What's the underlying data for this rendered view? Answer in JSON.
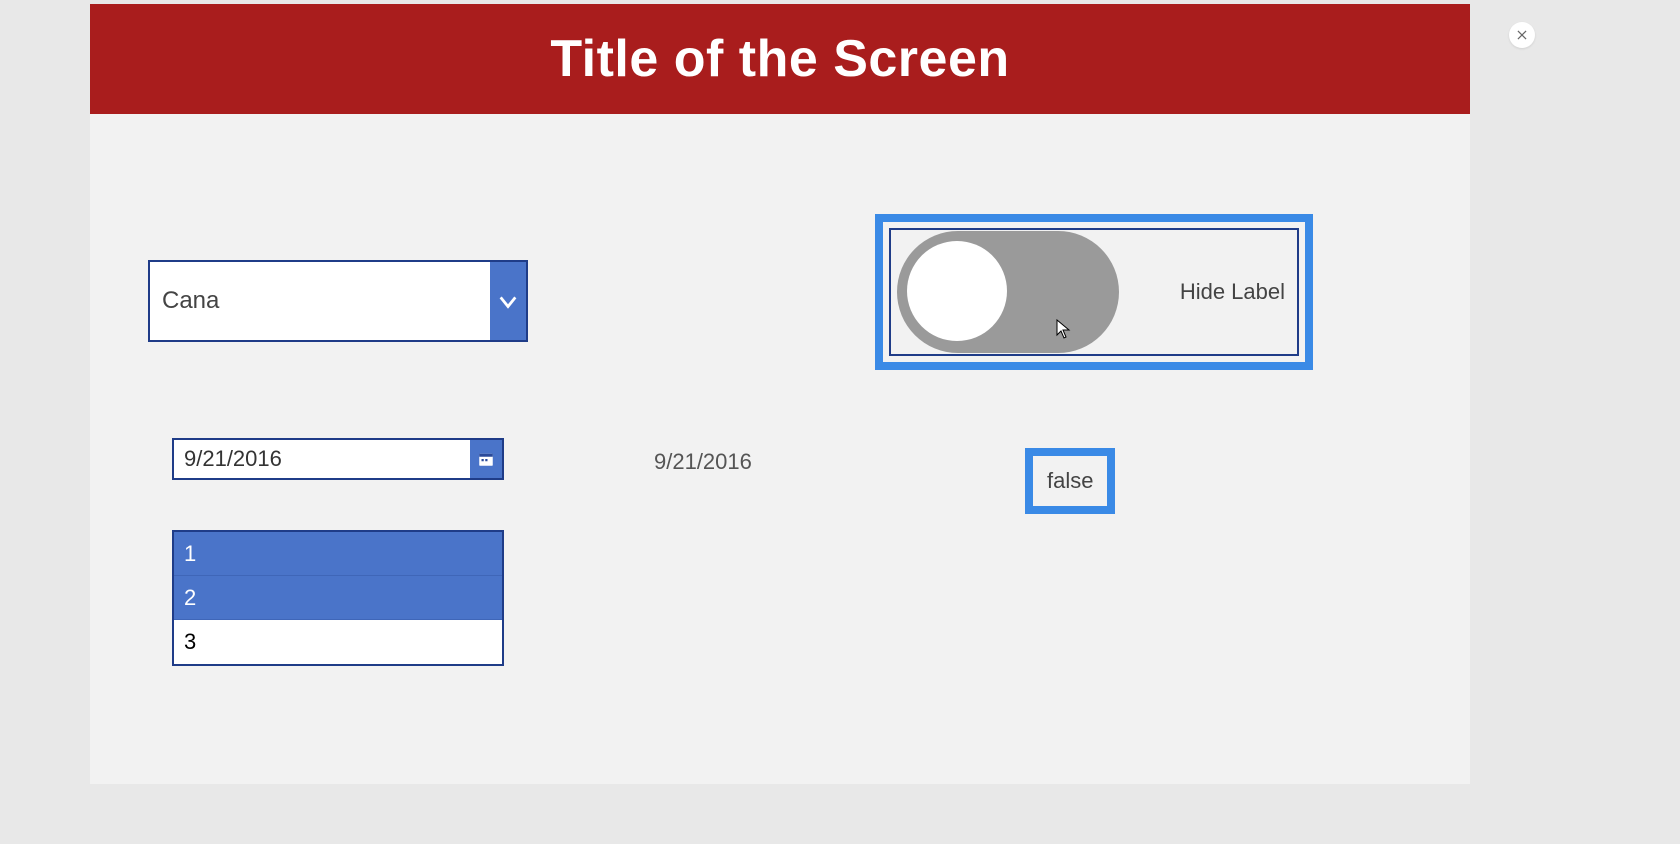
{
  "header": {
    "title": "Title of the Screen"
  },
  "dropdown": {
    "value": "Cana"
  },
  "date_picker": {
    "value": "9/21/2016"
  },
  "date_output": "9/21/2016",
  "listbox": {
    "items": [
      "1",
      "2",
      "3"
    ],
    "selected": [
      0,
      1
    ]
  },
  "toggle": {
    "label": "Hide Label",
    "state": false
  },
  "toggle_value_display": "false"
}
